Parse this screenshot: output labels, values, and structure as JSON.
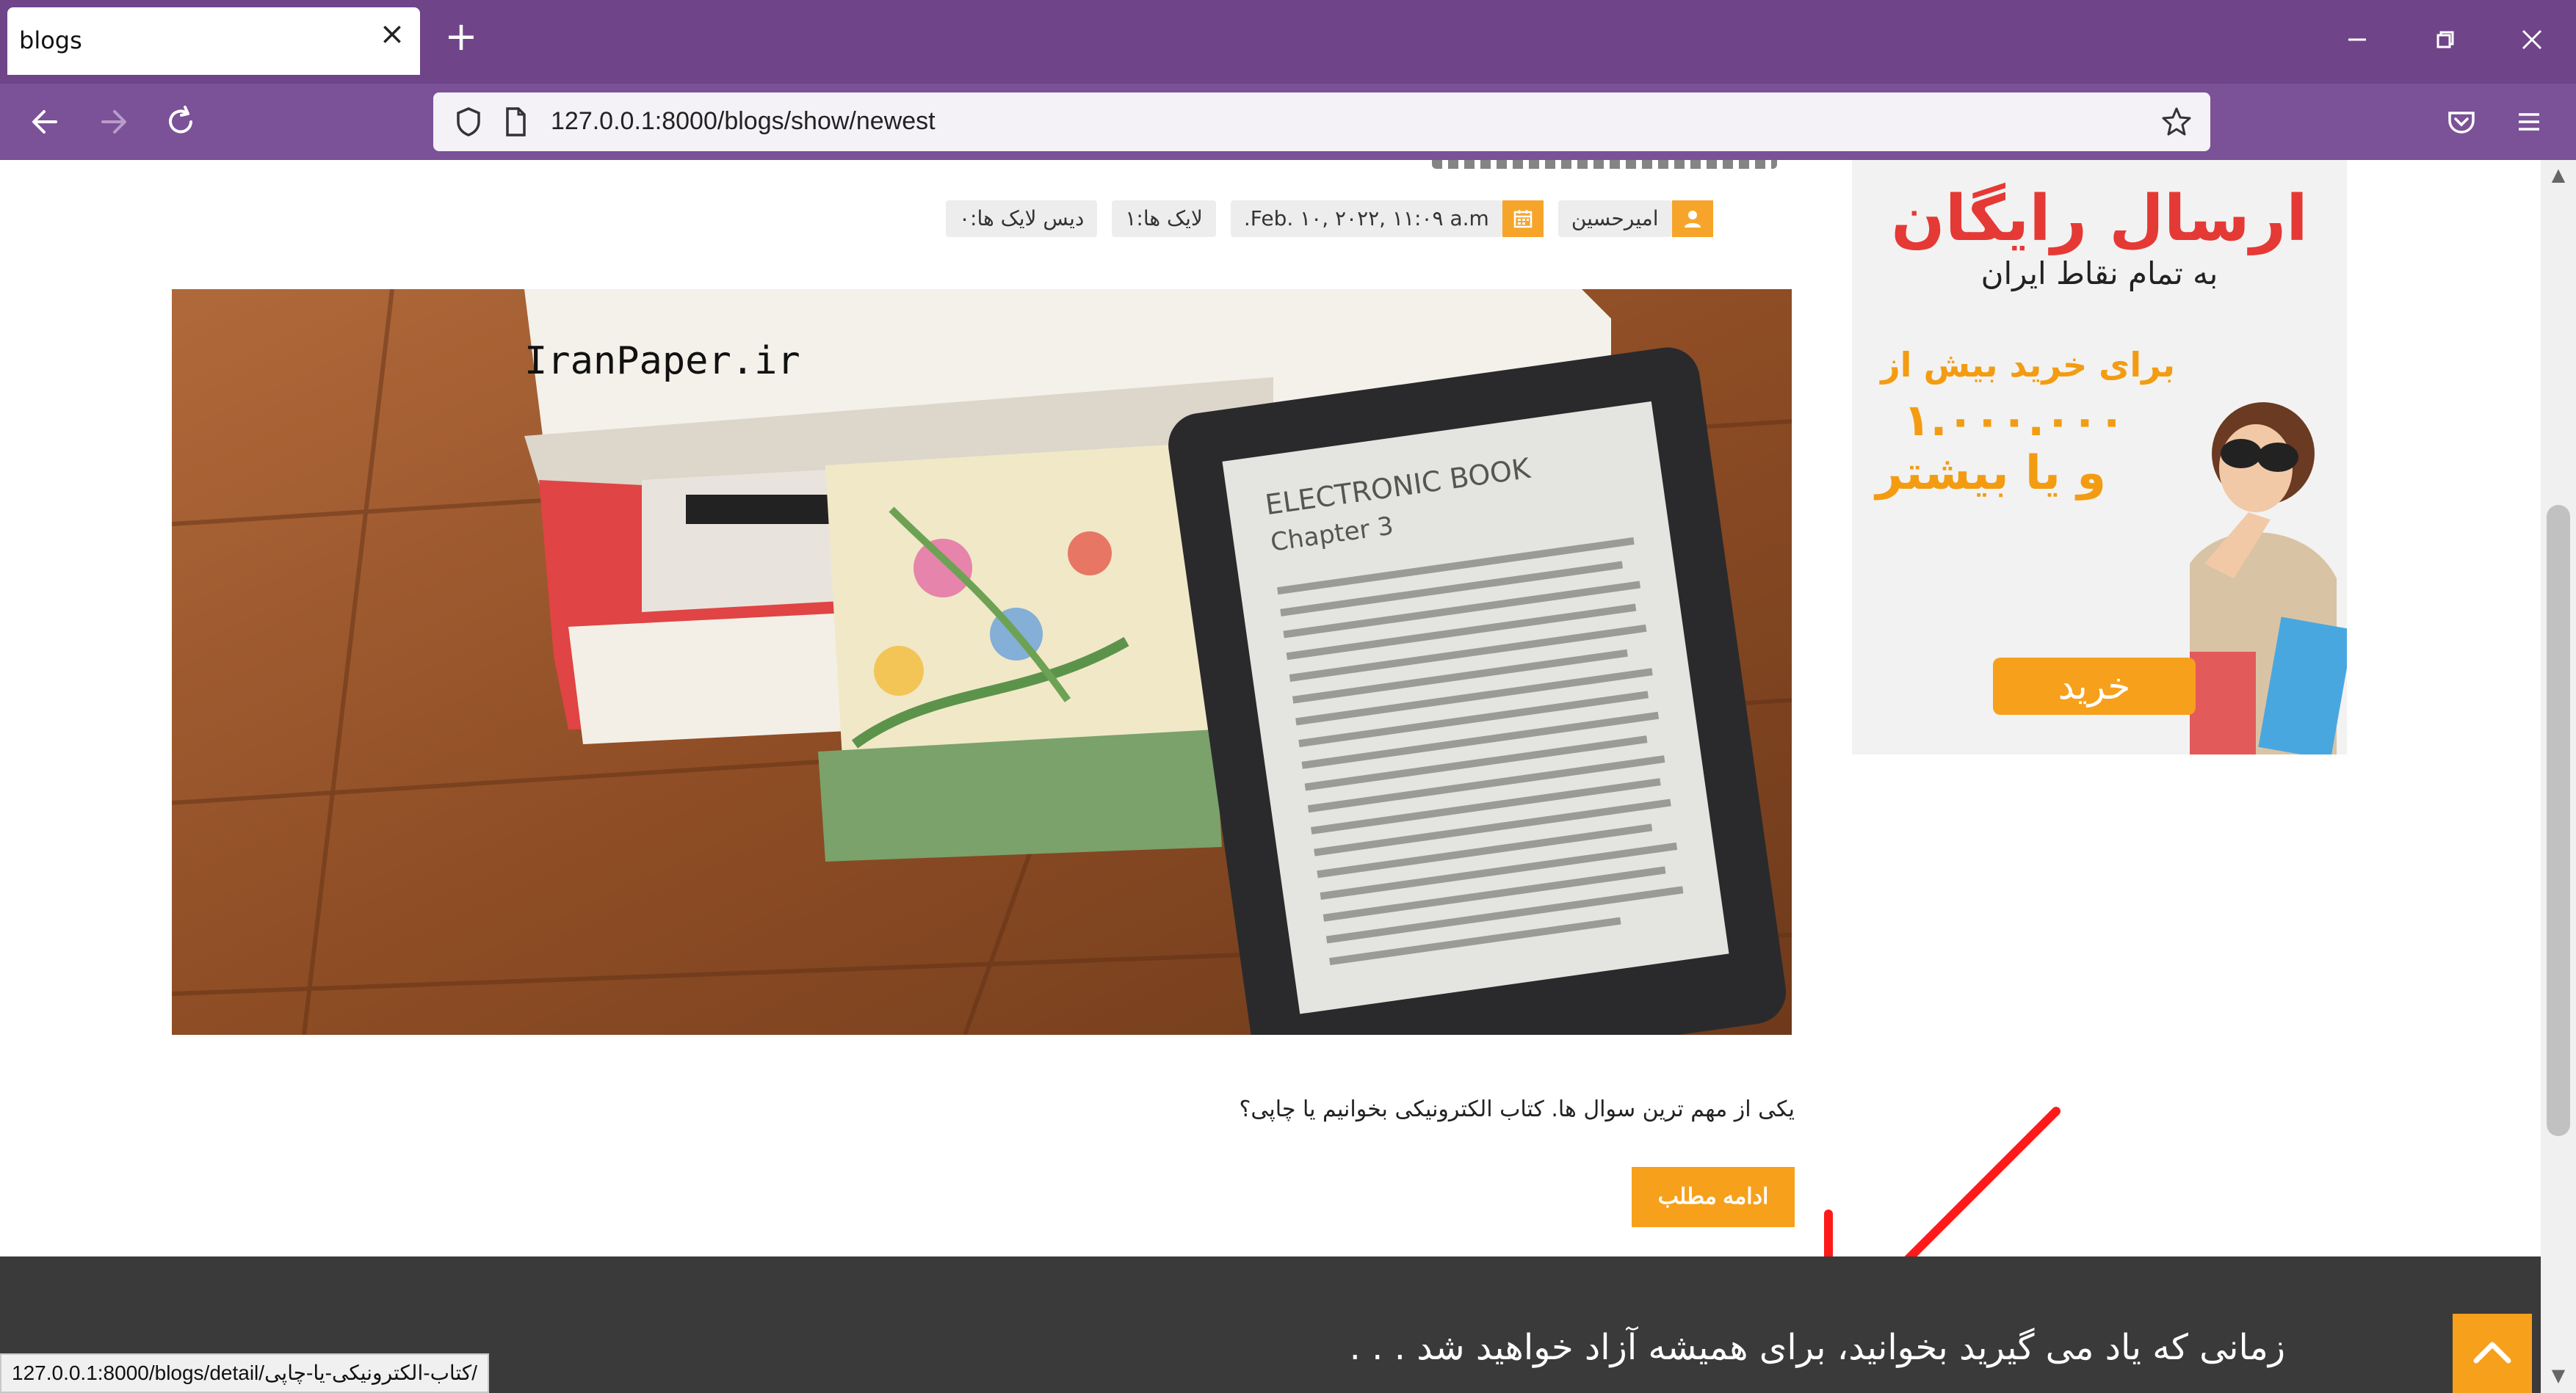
{
  "browser": {
    "tab_title": "blogs",
    "url": "127.0.0.1:8000/blogs/show/newest",
    "status_url": "127.0.0.1:8000/blogs/detail/کتاب-الکترونیکی-یا-چاپی/"
  },
  "post": {
    "author": "امیرحسین",
    "date": "Feb. ۱۰, ۲۰۲۲, ۱۱:۰۹ a.m.",
    "likes": "لایک ها:۱",
    "dislikes": "دیس لایک ها:۰",
    "image_text_ebook_title": "ELECTRONIC BOOK",
    "image_text_chapter": "Chapter 3",
    "image_text_brand": "IranPaper.ir",
    "excerpt": "یکی از مهم ترین سوال ها. کتاب الکترونیکی بخوانیم یا چاپی؟",
    "read_more": "ادامه مطلب"
  },
  "ad": {
    "title": "ارسال رایگان",
    "subtitle": "به تمام نقاط ایران",
    "line1": "برای خرید بیش از",
    "amount": "۱.۰۰۰.۰۰۰",
    "line3": "و یا بیشتر",
    "button": "خرید"
  },
  "footer": {
    "quote": "زمانی که یاد می گیرید بخوانید، برای همیشه آزاد خواهید شد . . ."
  },
  "colors": {
    "accent": "#f7a01b",
    "browser_chrome": "#6f4488",
    "footer_bg": "#3a3a3a",
    "ad_red": "#e53935"
  }
}
